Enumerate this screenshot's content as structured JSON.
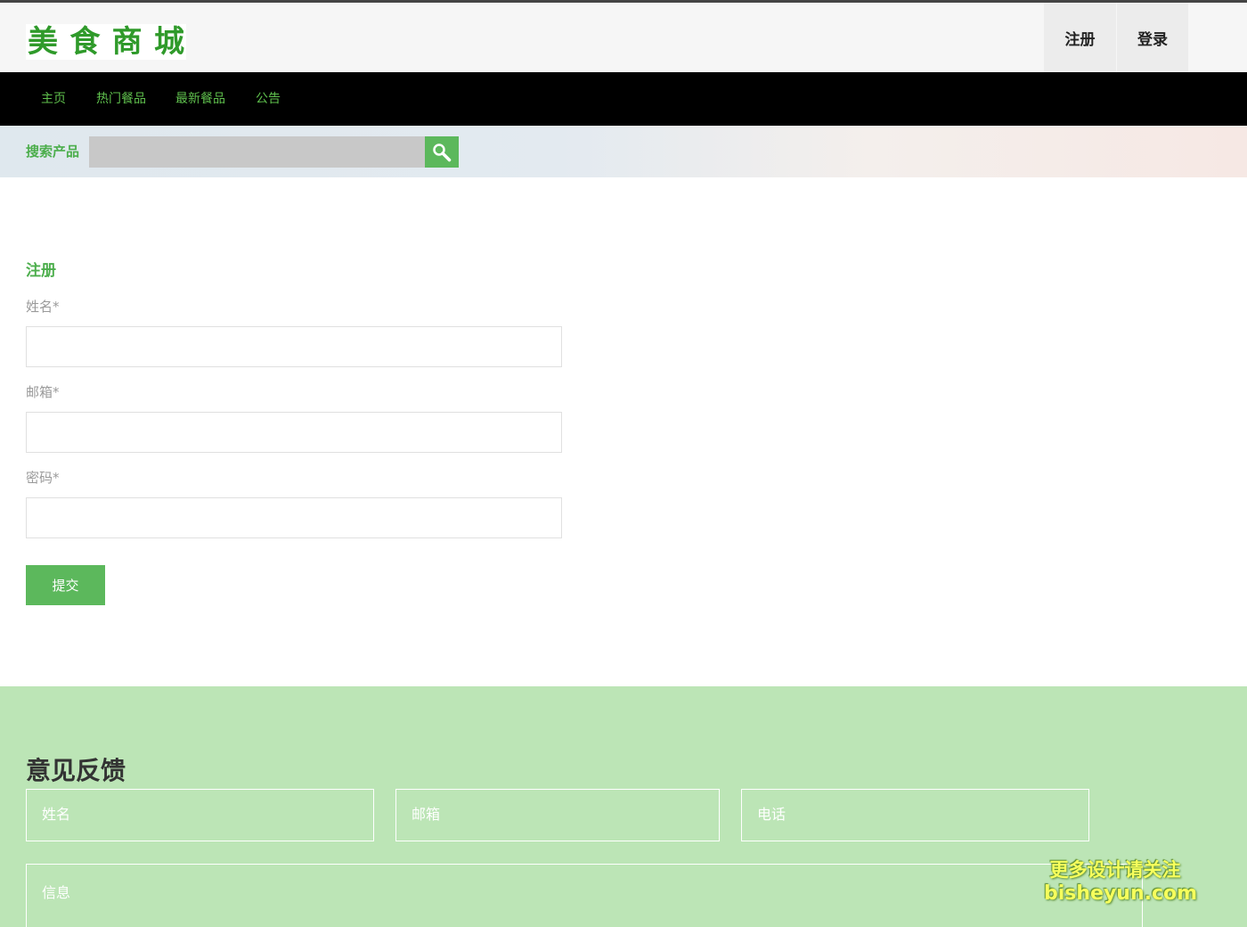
{
  "brand": {
    "logo_chars": [
      "美",
      "食",
      "商",
      "城"
    ]
  },
  "header": {
    "register_label": "注册",
    "login_label": "登录"
  },
  "nav": {
    "items": [
      "主页",
      "热门餐品",
      "最新餐品",
      "公告"
    ]
  },
  "search": {
    "label": "搜索产品",
    "placeholder": ""
  },
  "register_form": {
    "title": "注册",
    "name_label": "姓名*",
    "email_label": "邮箱*",
    "password_label": "密码*",
    "submit_label": "提交"
  },
  "feedback": {
    "title": "意见反馈",
    "name_placeholder": "姓名",
    "email_placeholder": "邮箱",
    "phone_placeholder": "电话",
    "message_placeholder": "信息"
  },
  "watermark": {
    "line1": "更多设计请关注",
    "line2": "bisheyun.com"
  },
  "colors": {
    "accent": "#5cb85c",
    "nav_bg": "#000000",
    "footer_bg": "#bce5b6",
    "logo": "#2f9a2a"
  }
}
